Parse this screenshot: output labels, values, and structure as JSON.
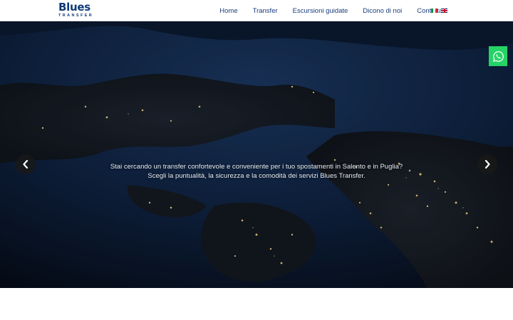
{
  "brand": {
    "name": "Blues",
    "tagline": "TRANSFER"
  },
  "nav": {
    "items": [
      {
        "label": "Home"
      },
      {
        "label": "Transfer"
      },
      {
        "label": "Escursioni guidate"
      },
      {
        "label": "Dicono di noi"
      },
      {
        "label": "Contattaci"
      }
    ]
  },
  "languages": [
    {
      "code": "it"
    },
    {
      "code": "en"
    }
  ],
  "hero": {
    "line1": "Stai cercando un transfer confortevole e conveniente per i tuo spostamenti in Salento e in Puglia?",
    "line2": "Scegli la puntualità, la sicurezza e la comodità dei servizi Blues Transfer."
  },
  "icons": {
    "prev": "chevron-left-icon",
    "next": "chevron-right-icon",
    "whatsapp": "whatsapp-icon"
  },
  "colors": {
    "brand": "#0f3a78",
    "nav_text": "#1a3d7c",
    "whatsapp": "#25d366",
    "hero_overlay": "#0a1426"
  }
}
